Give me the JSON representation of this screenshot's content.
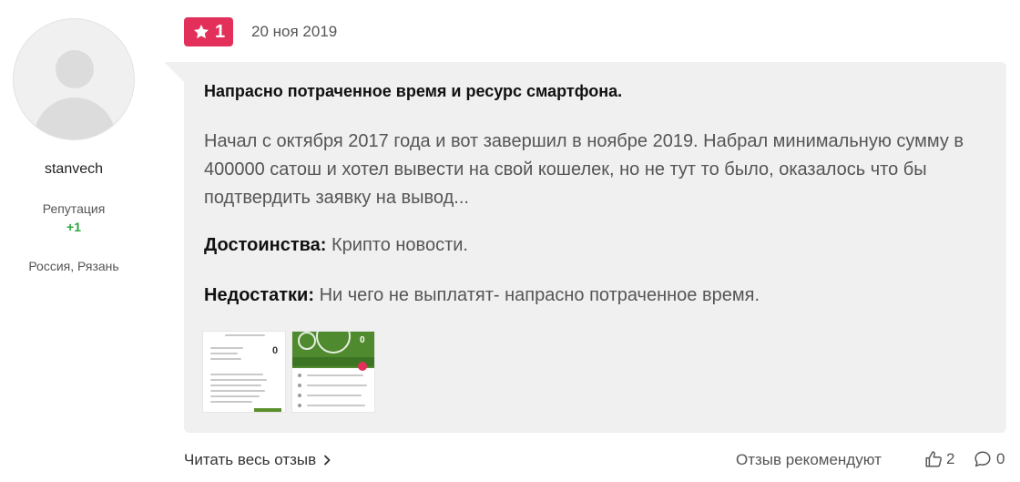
{
  "author": {
    "name": "stanvech",
    "reputation_label": "Репутация",
    "reputation_value": "+1",
    "location": "Россия, Рязань"
  },
  "review": {
    "rating": "1",
    "date": "20 ноя 2019",
    "title": "Напрасно потраченное время и ресурс смартфона.",
    "text": "Начал с октября 2017 года и вот завершил в ноябре 2019. Набрал минимальную сумму в 400000 сатош и хотел вывести на свой кошелек, но не тут то было, оказалось что бы подтвердить заявку на вывод...",
    "pros_label": "Достоинства:",
    "pros_text": "Крипто новости.",
    "cons_label": "Недостатки:",
    "cons_text": "Ни чего не выплатят- напрасно потраченное время."
  },
  "footer": {
    "read_more_label": "Читать весь отзыв",
    "recommend_label": "Отзыв рекомендуют",
    "likes_count": "2",
    "comments_count": "0"
  },
  "colors": {
    "badge": "#e3305b",
    "card_bg": "#f0f0f0",
    "reputation_positive": "#2aa63c"
  },
  "icons": [
    "user-avatar-placeholder",
    "star-icon",
    "chevron-right-icon",
    "thumbs-up-icon",
    "comment-icon"
  ]
}
